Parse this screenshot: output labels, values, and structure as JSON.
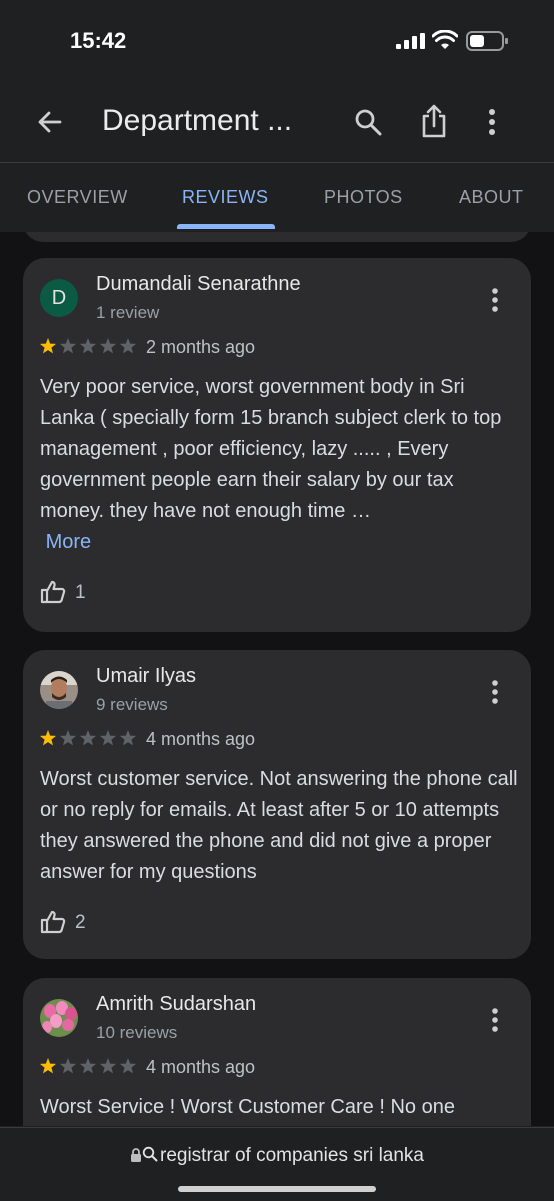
{
  "status_bar": {
    "time": "15:42"
  },
  "app_bar": {
    "title": "Department ..."
  },
  "tabs": [
    {
      "label": "OVERVIEW",
      "active": false
    },
    {
      "label": "REVIEWS",
      "active": true
    },
    {
      "label": "PHOTOS",
      "active": false
    },
    {
      "label": "ABOUT",
      "active": false
    }
  ],
  "reviews": [
    {
      "avatar_letter": "D",
      "name": "Dumandali Senarathne",
      "review_count": "1 review",
      "rating": 1,
      "time_ago": "2 months ago",
      "text": "Very poor service, worst government body in Sri Lanka ( specially form 15 branch subject clerk to top management , poor efficiency, lazy ..... , Every government people earn their salary by our tax money. they have not enough time …",
      "more_label": "More",
      "likes": "1"
    },
    {
      "avatar_letter": "",
      "name": "Umair Ilyas",
      "review_count": "9 reviews",
      "rating": 1,
      "time_ago": "4 months ago",
      "text": "Worst customer service. Not answering the phone call or no reply for emails. At least after 5 or 10 attempts they answered the phone and did not give a proper answer for my questions",
      "more_label": "",
      "likes": "2"
    },
    {
      "avatar_letter": "",
      "name": "Amrith Sudarshan",
      "review_count": "10 reviews",
      "rating": 1,
      "time_ago": "4 months ago",
      "text": "Worst Service ! Worst Customer Care ! No one",
      "more_label": "",
      "likes": ""
    }
  ],
  "url_bar": {
    "text": "registrar of companies sri lanka"
  },
  "colors": {
    "accent": "#8ab4f8",
    "star_filled": "#fbbc04",
    "star_empty": "#5f6368"
  }
}
